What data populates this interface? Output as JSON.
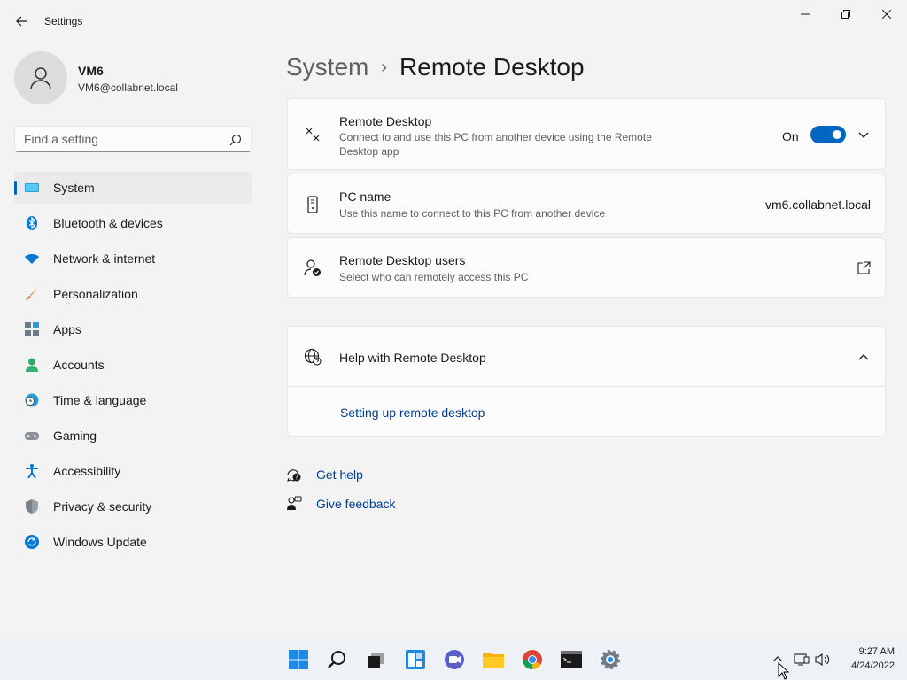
{
  "window": {
    "title": "Settings"
  },
  "profile": {
    "name": "VM6",
    "email": "VM6@collabnet.local"
  },
  "search": {
    "placeholder": "Find a setting"
  },
  "sidebar": {
    "items": [
      {
        "label": "System",
        "icon": "monitor-icon",
        "active": true
      },
      {
        "label": "Bluetooth & devices",
        "icon": "bluetooth-icon"
      },
      {
        "label": "Network & internet",
        "icon": "wifi-icon"
      },
      {
        "label": "Personalization",
        "icon": "paintbrush-icon"
      },
      {
        "label": "Apps",
        "icon": "apps-icon"
      },
      {
        "label": "Accounts",
        "icon": "person-icon"
      },
      {
        "label": "Time & language",
        "icon": "clock-globe-icon"
      },
      {
        "label": "Gaming",
        "icon": "gamepad-icon"
      },
      {
        "label": "Accessibility",
        "icon": "accessibility-icon"
      },
      {
        "label": "Privacy & security",
        "icon": "shield-icon"
      },
      {
        "label": "Windows Update",
        "icon": "update-icon"
      }
    ]
  },
  "breadcrumb": {
    "parent": "System",
    "separator": "›",
    "current": "Remote Desktop"
  },
  "remote_desktop": {
    "title": "Remote Desktop",
    "description": "Connect to and use this PC from another device using the Remote Desktop app",
    "toggle_label": "On",
    "toggle_state": true
  },
  "pc_name": {
    "title": "PC name",
    "description": "Use this name to connect to this PC from another device",
    "value": "vm6.collabnet.local"
  },
  "rd_users": {
    "title": "Remote Desktop users",
    "description": "Select who can remotely access this PC"
  },
  "help": {
    "title": "Help with Remote Desktop",
    "link": "Setting up remote desktop"
  },
  "footer": {
    "get_help": "Get help",
    "give_feedback": "Give feedback"
  },
  "taskbar": {
    "apps": [
      "start-icon",
      "search-icon",
      "task-view-icon",
      "widgets-icon",
      "teams-chat-icon",
      "file-explorer-icon",
      "chrome-icon",
      "terminal-icon",
      "settings-icon"
    ],
    "active_app": "settings-icon",
    "clock_time": "9:27 AM",
    "clock_date": "4/24/2022"
  },
  "colors": {
    "accent": "#0067c0",
    "link": "#003e92",
    "background": "#f3f3f3",
    "card": "#fbfbfb"
  }
}
